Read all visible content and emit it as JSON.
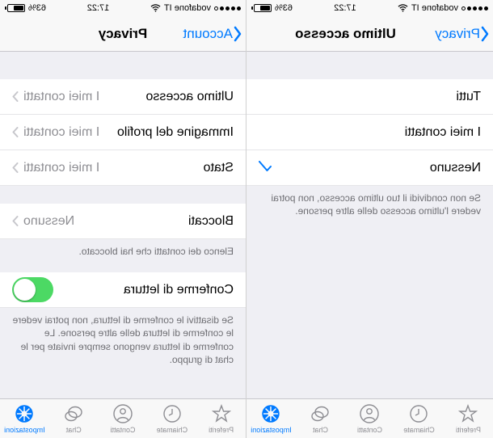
{
  "statusbar": {
    "carrier": "vodafone IT",
    "time": "17:22",
    "battery_pct": "63%"
  },
  "left_screen": {
    "back_label": "Account",
    "title": "Privacy",
    "rows": [
      {
        "label": "Ultimo accesso",
        "value": "I miei contatti"
      },
      {
        "label": "Immagine del profilo",
        "value": "I miei contatti"
      },
      {
        "label": "Stato",
        "value": "I miei contatti"
      }
    ],
    "blocked": {
      "label": "Bloccati",
      "value": "Nessuno"
    },
    "blocked_footer": "Elenco dei contatti che hai bloccato.",
    "read_receipts": {
      "label": "Conferme di lettura"
    },
    "read_receipts_footer": "Se disattivi le conferme di lettura, non potrai vedere le conferme di lettura delle altre persone. Le conferme di lettura vengono sempre inviate per le chat di gruppo."
  },
  "right_screen": {
    "back_label": "Privacy",
    "title": "Ultimo accesso",
    "options": [
      {
        "label": "Tutti",
        "checked": false
      },
      {
        "label": "I miei contatti",
        "checked": false
      },
      {
        "label": "Nessuno",
        "checked": true
      }
    ],
    "footer": "Se non condividi il tuo ultimo accesso, non potrai vedere l'ultimo accesso delle altre persone."
  },
  "tabs": {
    "favorites": "Preferiti",
    "recents": "Chiamate",
    "contacts": "Contatti",
    "chat": "Chat",
    "settings": "Impostazioni"
  }
}
